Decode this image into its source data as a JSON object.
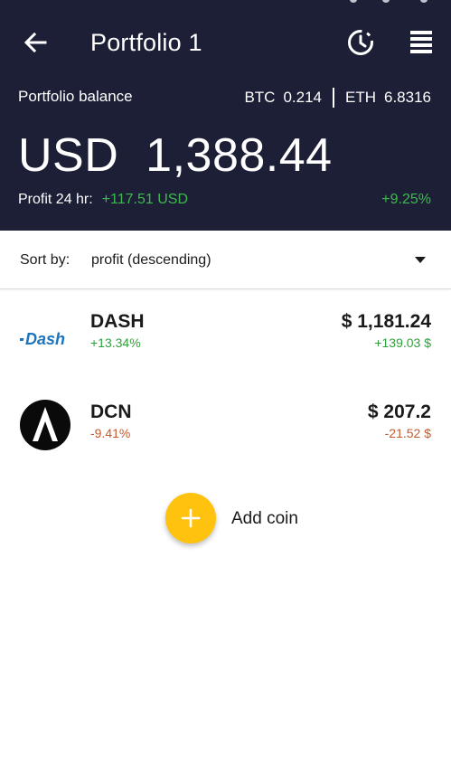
{
  "header": {
    "title": "Portfolio 1",
    "back_icon": "back-arrow-icon",
    "history_icon": "history-clock-icon",
    "menu_icon": "list-menu-icon"
  },
  "balance": {
    "label": "Portfolio balance",
    "btc_symbol": "BTC",
    "btc_value": "0.214",
    "eth_symbol": "ETH",
    "eth_value": "6.8316",
    "amount": "USD  1,388.44",
    "profit_label": "Profit 24 hr:",
    "profit_value": "+117.51 USD",
    "profit_percent": "+9.25%"
  },
  "sort": {
    "label": "Sort by:",
    "value": "profit  (descending)"
  },
  "coins": [
    {
      "name": "DASH",
      "change": "+13.34%",
      "price": "$ 1,181.24",
      "delta": "+139.03 $",
      "direction": "up",
      "logo_text": "Dash"
    },
    {
      "name": "DCN",
      "change": "-9.41%",
      "price": "$ 207.2",
      "delta": "-21.52 $",
      "direction": "down",
      "logo_text": ""
    }
  ],
  "add": {
    "label": "Add coin",
    "icon": "plus-icon"
  },
  "colors": {
    "header_bg": "#1c1f35",
    "profit_green": "#3dba4d",
    "positive": "#2e9f3a",
    "negative": "#c55a2b",
    "accent_yellow": "#ffc20e",
    "dash_blue": "#1c75bc"
  }
}
